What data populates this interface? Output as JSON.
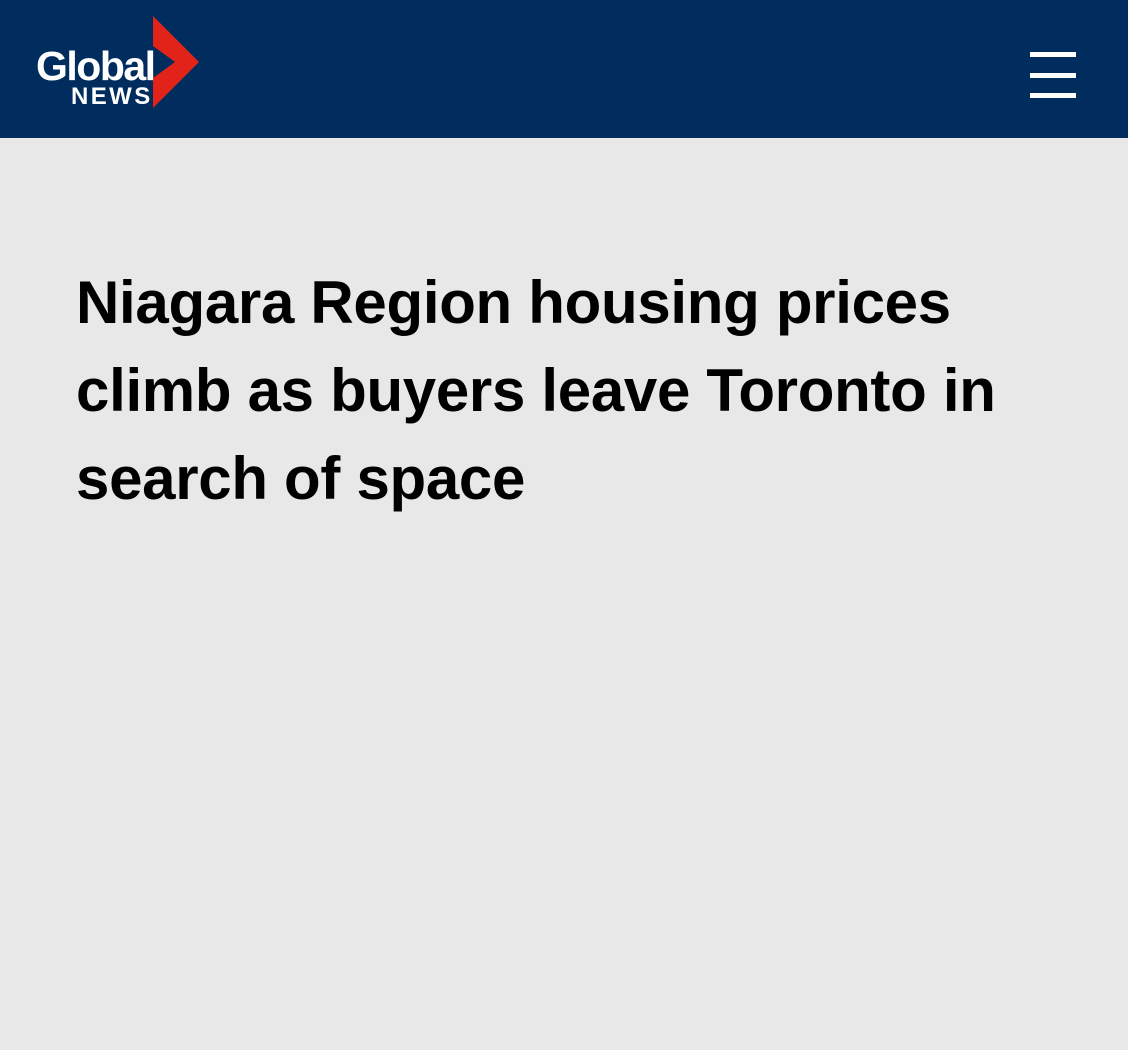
{
  "header": {
    "logo": {
      "line1": "Global",
      "line2": "NEWS",
      "chevron_icon": "play-chevron-icon"
    },
    "menu_icon": "hamburger-menu-icon"
  },
  "article": {
    "headline": "Niagara Region housing prices climb as buyers leave Toronto in search of space"
  },
  "colors": {
    "header_background": "#002d5e",
    "page_background": "#e8e8e8",
    "brand_red": "#e2231a",
    "headline_text": "#000000",
    "icon_color": "#ffffff"
  }
}
